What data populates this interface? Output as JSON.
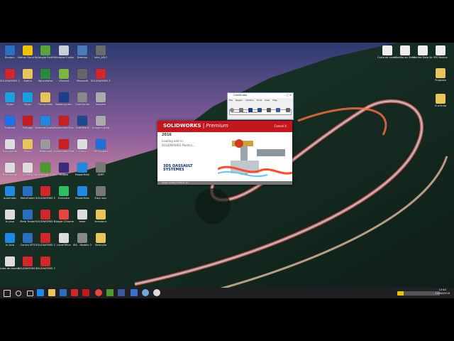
{
  "desktop": {
    "left_icons": [
      {
        "label": "Bonjour",
        "icon": "globe-icon",
        "color": "#2d6fc4"
      },
      {
        "label": "Norton Security",
        "icon": "shield-check-icon",
        "color": "#f2c200"
      },
      {
        "label": "Google Earth",
        "icon": "earth-icon",
        "color": "#58a33c"
      },
      {
        "label": "Windows Explorer",
        "icon": "window-icon",
        "color": "#c9cfd8"
      },
      {
        "label": "Desktop",
        "icon": "monitor-icon",
        "color": "#4a7ab8"
      },
      {
        "label": "Intel_ASIO",
        "icon": "app-icon",
        "color": "#6b6b6b"
      },
      {
        "label": "SOLIDWORKS Composer",
        "icon": "sw-icon",
        "color": "#d2262b"
      },
      {
        "label": "Atalho",
        "icon": "folder-icon",
        "color": "#e7c55a"
      },
      {
        "label": "Wincrelator",
        "icon": "app-icon",
        "color": "#2a8a3a"
      },
      {
        "label": "uTorrent",
        "icon": "torrent-icon",
        "color": "#79b83b"
      },
      {
        "label": "Microsoft",
        "icon": "app-icon",
        "color": "#666"
      },
      {
        "label": "SOLIDWORKS Explorer",
        "icon": "sw-icon",
        "color": "#d2262b"
      },
      {
        "label": "Skype",
        "icon": "skype-icon",
        "color": "#1aa0e1"
      },
      {
        "label": "Skype",
        "icon": "skype-icon",
        "color": "#1aa0e1"
      },
      {
        "label": "Fotografias",
        "icon": "folder-icon",
        "color": "#e7c55a"
      },
      {
        "label": "Booking.com",
        "icon": "booking-icon",
        "color": "#1c3f8a"
      },
      {
        "label": "CamStudio",
        "icon": "camera-icon",
        "color": "#888"
      },
      {
        "label": "Imagem",
        "icon": "image-icon",
        "color": "#aaa"
      },
      {
        "label": "Tradutor",
        "icon": "app-icon",
        "color": "#1a73e8"
      },
      {
        "label": "Portugal",
        "icon": "flag-icon",
        "color": "#c41c1c"
      },
      {
        "label": "Internet Explorer",
        "icon": "ie-icon",
        "color": "#1e88e5"
      },
      {
        "label": "Connected Music",
        "icon": "music-icon",
        "color": "#c82020"
      },
      {
        "label": "DraftSight",
        "icon": "ds-icon",
        "color": "#1a4a8a"
      },
      {
        "label": "Imagem Jpeg",
        "icon": "image-icon",
        "color": "#aaa"
      },
      {
        "label": "Documento",
        "icon": "document-icon",
        "color": "#ddd"
      },
      {
        "label": "Pasta",
        "icon": "folder-icon",
        "color": "#e7c55a"
      },
      {
        "label": "Telemovel",
        "icon": "phone-icon",
        "color": "#999"
      },
      {
        "label": "Connected Photo",
        "icon": "photo-icon",
        "color": "#c82020"
      },
      {
        "label": "Carta",
        "icon": "document-icon",
        "color": "#ddd"
      },
      {
        "label": "HP Support",
        "icon": "help-icon",
        "color": "#1e6fd9"
      },
      {
        "label": "Documento",
        "icon": "document-icon",
        "color": "#ddd"
      },
      {
        "label": "CAPSBD",
        "icon": "document-icon",
        "color": "#ddd"
      },
      {
        "label": "eDrawings 2016 x64",
        "icon": "edrawings-icon",
        "color": "#4c9a2a"
      },
      {
        "label": "eclipse",
        "icon": "eclipse-icon",
        "color": "#3c2a7a"
      },
      {
        "label": "RepairHelp",
        "icon": "ie-icon",
        "color": "#1e88e5"
      },
      {
        "label": "GIMP",
        "icon": "app-icon",
        "color": "#777"
      },
      {
        "label": "Automatic",
        "icon": "ie-icon",
        "color": "#1e88e5"
      },
      {
        "label": "MetaTrader",
        "icon": "check-icon",
        "color": "#2a6fbf"
      },
      {
        "label": "SOLIDWORKS Explorer 2016",
        "icon": "sw-icon",
        "color": "#d2262b"
      },
      {
        "label": "Evernote",
        "icon": "evernote-icon",
        "color": "#2dbe60"
      },
      {
        "label": "RepairHelp",
        "icon": "ie-icon",
        "color": "#1e88e5"
      },
      {
        "label": "Easy way",
        "icon": "app-icon",
        "color": "#777"
      },
      {
        "label": "In Java",
        "icon": "document-icon",
        "color": "#ddd"
      },
      {
        "label": "Meta Trader",
        "icon": "check-icon",
        "color": "#2a6fbf"
      },
      {
        "label": "SOLIDWORKS Electrical",
        "icon": "sw-icon",
        "color": "#d2262b"
      },
      {
        "label": "Google Chrome",
        "icon": "chrome-icon",
        "color": "#e8453c"
      },
      {
        "label": "teste",
        "icon": "document-icon",
        "color": "#ddd"
      },
      {
        "label": "transferir",
        "icon": "folder-icon",
        "color": "#e7c55a"
      },
      {
        "label": "In Java",
        "icon": "ie-icon",
        "color": "#1e88e5"
      },
      {
        "label": "Contra MT5",
        "icon": "check-icon",
        "color": "#2a6fbf"
      },
      {
        "label": "SOLIDWORKS Composer",
        "icon": "sw-icon",
        "color": "#d2262b"
      },
      {
        "label": "LibreOffice",
        "icon": "document-icon",
        "color": "#ddd"
      },
      {
        "label": "IBS - Modelo 3",
        "icon": "app-icon",
        "color": "#888"
      },
      {
        "label": "Selecção",
        "icon": "folder-icon",
        "color": "#e7c55a"
      },
      {
        "label": "Lista de downloads",
        "icon": "document-icon",
        "color": "#ddd"
      },
      {
        "label": "SOLIDWORKS 2016 x64",
        "icon": "sw-icon",
        "color": "#d2262b"
      },
      {
        "label": "SOLIDWORKS Composer",
        "icon": "sw-icon",
        "color": "#d2262b"
      }
    ],
    "right_icons": [
      {
        "label": "Carta de candidatura",
        "icon": "document-icon",
        "color": "#eee"
      },
      {
        "label": "Cartão do Cidadão",
        "icon": "document-icon",
        "color": "#eee"
      },
      {
        "label": "Market Data Actions",
        "icon": "document-icon",
        "color": "#eee"
      },
      {
        "label": "IRS Marina",
        "icon": "document-icon",
        "color": "#eee"
      },
      {
        "label": "Proposta",
        "icon": "folder-icon",
        "color": "#e7c55a"
      },
      {
        "label": "Currículo",
        "icon": "folder-icon",
        "color": "#e7c55a"
      }
    ]
  },
  "splash": {
    "brand": "SOLIDWORKS",
    "edition": "| Premium",
    "cancel": "Cancel X",
    "year": "2016",
    "loading_line1": "Loading add-in:",
    "loading_line2": "SOLIDWORKS Plastics...",
    "vendor": "3DS DASSAULT SYSTEMES",
    "copyright": "Image courtesy of Hitachi, Inc.",
    "colors": {
      "banner": "#c4161c",
      "vendor": "#0a2d6e"
    }
  },
  "camstudio": {
    "title": "CamStudio",
    "menu": [
      "File",
      "Region",
      "Options",
      "Tools",
      "View",
      "Help"
    ],
    "status": "Current Frame: 1 / 0000"
  },
  "taskbar": {
    "time": "12:40",
    "date": "12/08/2016"
  }
}
